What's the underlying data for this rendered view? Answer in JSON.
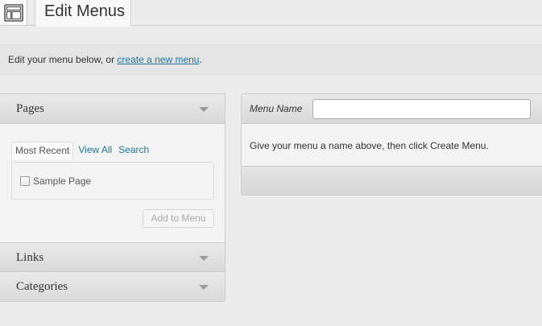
{
  "header": {
    "title": "Edit Menus",
    "icon": "menus-icon"
  },
  "intro": {
    "prefix": "Edit your menu below, or ",
    "link": "create a new menu",
    "suffix": "."
  },
  "accordion": {
    "pages": {
      "title": "Pages",
      "tabs": [
        "Most Recent",
        "View All",
        "Search"
      ],
      "items": [
        {
          "label": "Sample Page",
          "checked": false
        }
      ],
      "add_button": "Add to Menu"
    },
    "links": {
      "title": "Links"
    },
    "categories": {
      "title": "Categories"
    }
  },
  "menu_panel": {
    "name_label": "Menu Name",
    "name_value": "",
    "instructions": "Give your menu a name above, then click Create Menu."
  },
  "colors": {
    "link": "#21759b",
    "background": "#ececec",
    "panel_header": "#d9d9d9"
  }
}
